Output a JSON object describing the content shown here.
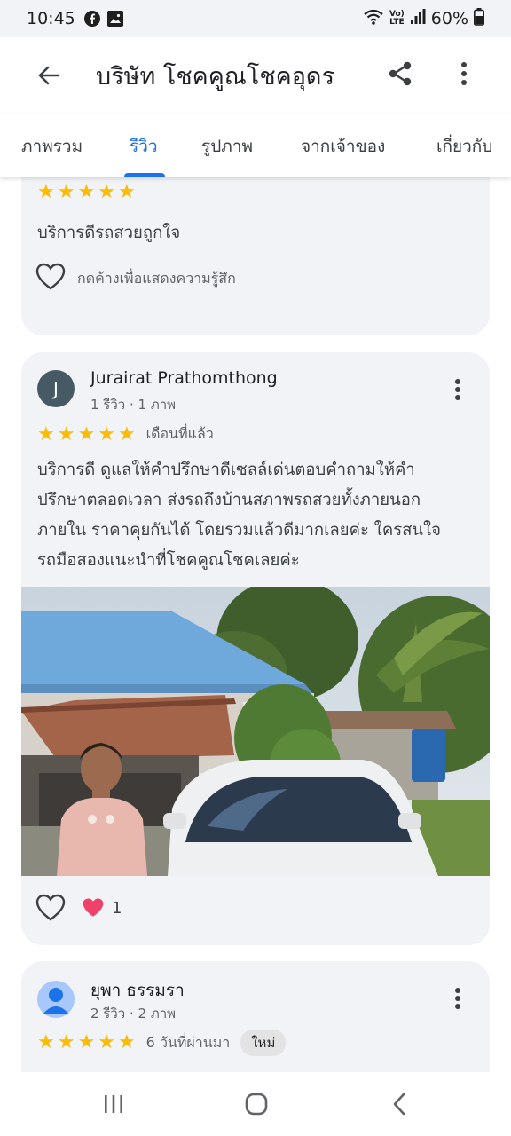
{
  "status_bar": {
    "time": "10:45",
    "left_icons": [
      "facebook-icon",
      "gallery-icon"
    ],
    "volte_line1": "Vo)",
    "volte_line2": "LTE",
    "battery": "60%"
  },
  "app_bar": {
    "title": "บริษัท โชคคูณโชคอุดร",
    "back_icon": "arrow-back-icon",
    "share_icon": "share-icon",
    "more_icon": "more-vert-icon"
  },
  "tabs": [
    {
      "label": "ภาพรวม"
    },
    {
      "label": "รีวิว"
    },
    {
      "label": "รูปภาพ"
    },
    {
      "label": "จากเจ้าของ"
    },
    {
      "label": "เกี่ยวกับ"
    }
  ],
  "active_tab": "รีวิว",
  "colors": {
    "accent": "#1a73e8",
    "star": "#fbbc04",
    "card_bg": "#f1f3f6",
    "heart_filled": "#f0416b"
  },
  "reviews": [
    {
      "rating": 5,
      "text": "บริการดีรถสวยถูกใจ",
      "reaction_hint": "กดค้างเพื่อแสดงความรู้สึก"
    },
    {
      "avatar_letter": "J",
      "name": "Jurairat Prathomthong",
      "meta": "1 รีวิว · 1 ภาพ",
      "rating": 5,
      "time": "เดือนที่แล้ว",
      "text_lines": [
        "บริการดี ดูแลให้คำปรึกษาดีเซลล์เด่นตอบคำถามให้คำ",
        "ปรึกษาตลอดเวลา ส่งรถถึงบ้านสภาพรถสวยทั้งภายนอก",
        "ภายใน ราคาคุยกันได้ โดยรวมแล้วดีมากเลยค่ะ ใครสนใจ",
        "รถมือสองแนะนำที่โชคคูณโชคเลยค่ะ"
      ],
      "reaction_count": "1"
    },
    {
      "name": "ยุพา ธรรมรา",
      "meta": "2 รีวิว · 2 ภาพ",
      "rating": 5,
      "time": "6 วันที่ผ่านมา",
      "badge": "ใหม่"
    }
  ]
}
